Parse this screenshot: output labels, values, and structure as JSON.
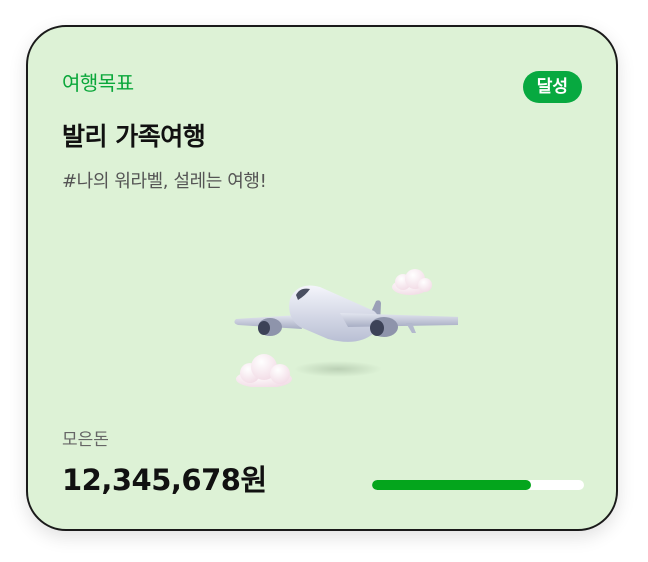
{
  "card": {
    "category_label": "여행목표",
    "status_badge": "달성",
    "title": "발리 가족여행",
    "subtitle": "#나의 워라벨, 설레는 여행!",
    "illustration_icon": "airplane-with-clouds",
    "saved_label": "모은돈",
    "saved_amount": "12,345,678원",
    "progress_percent": 75
  },
  "colors": {
    "card_background": "#ddf2d6",
    "accent_green": "#0aa73a",
    "badge_green": "#07a940",
    "progress_green": "#04a51c",
    "progress_track": "#ffffff"
  }
}
